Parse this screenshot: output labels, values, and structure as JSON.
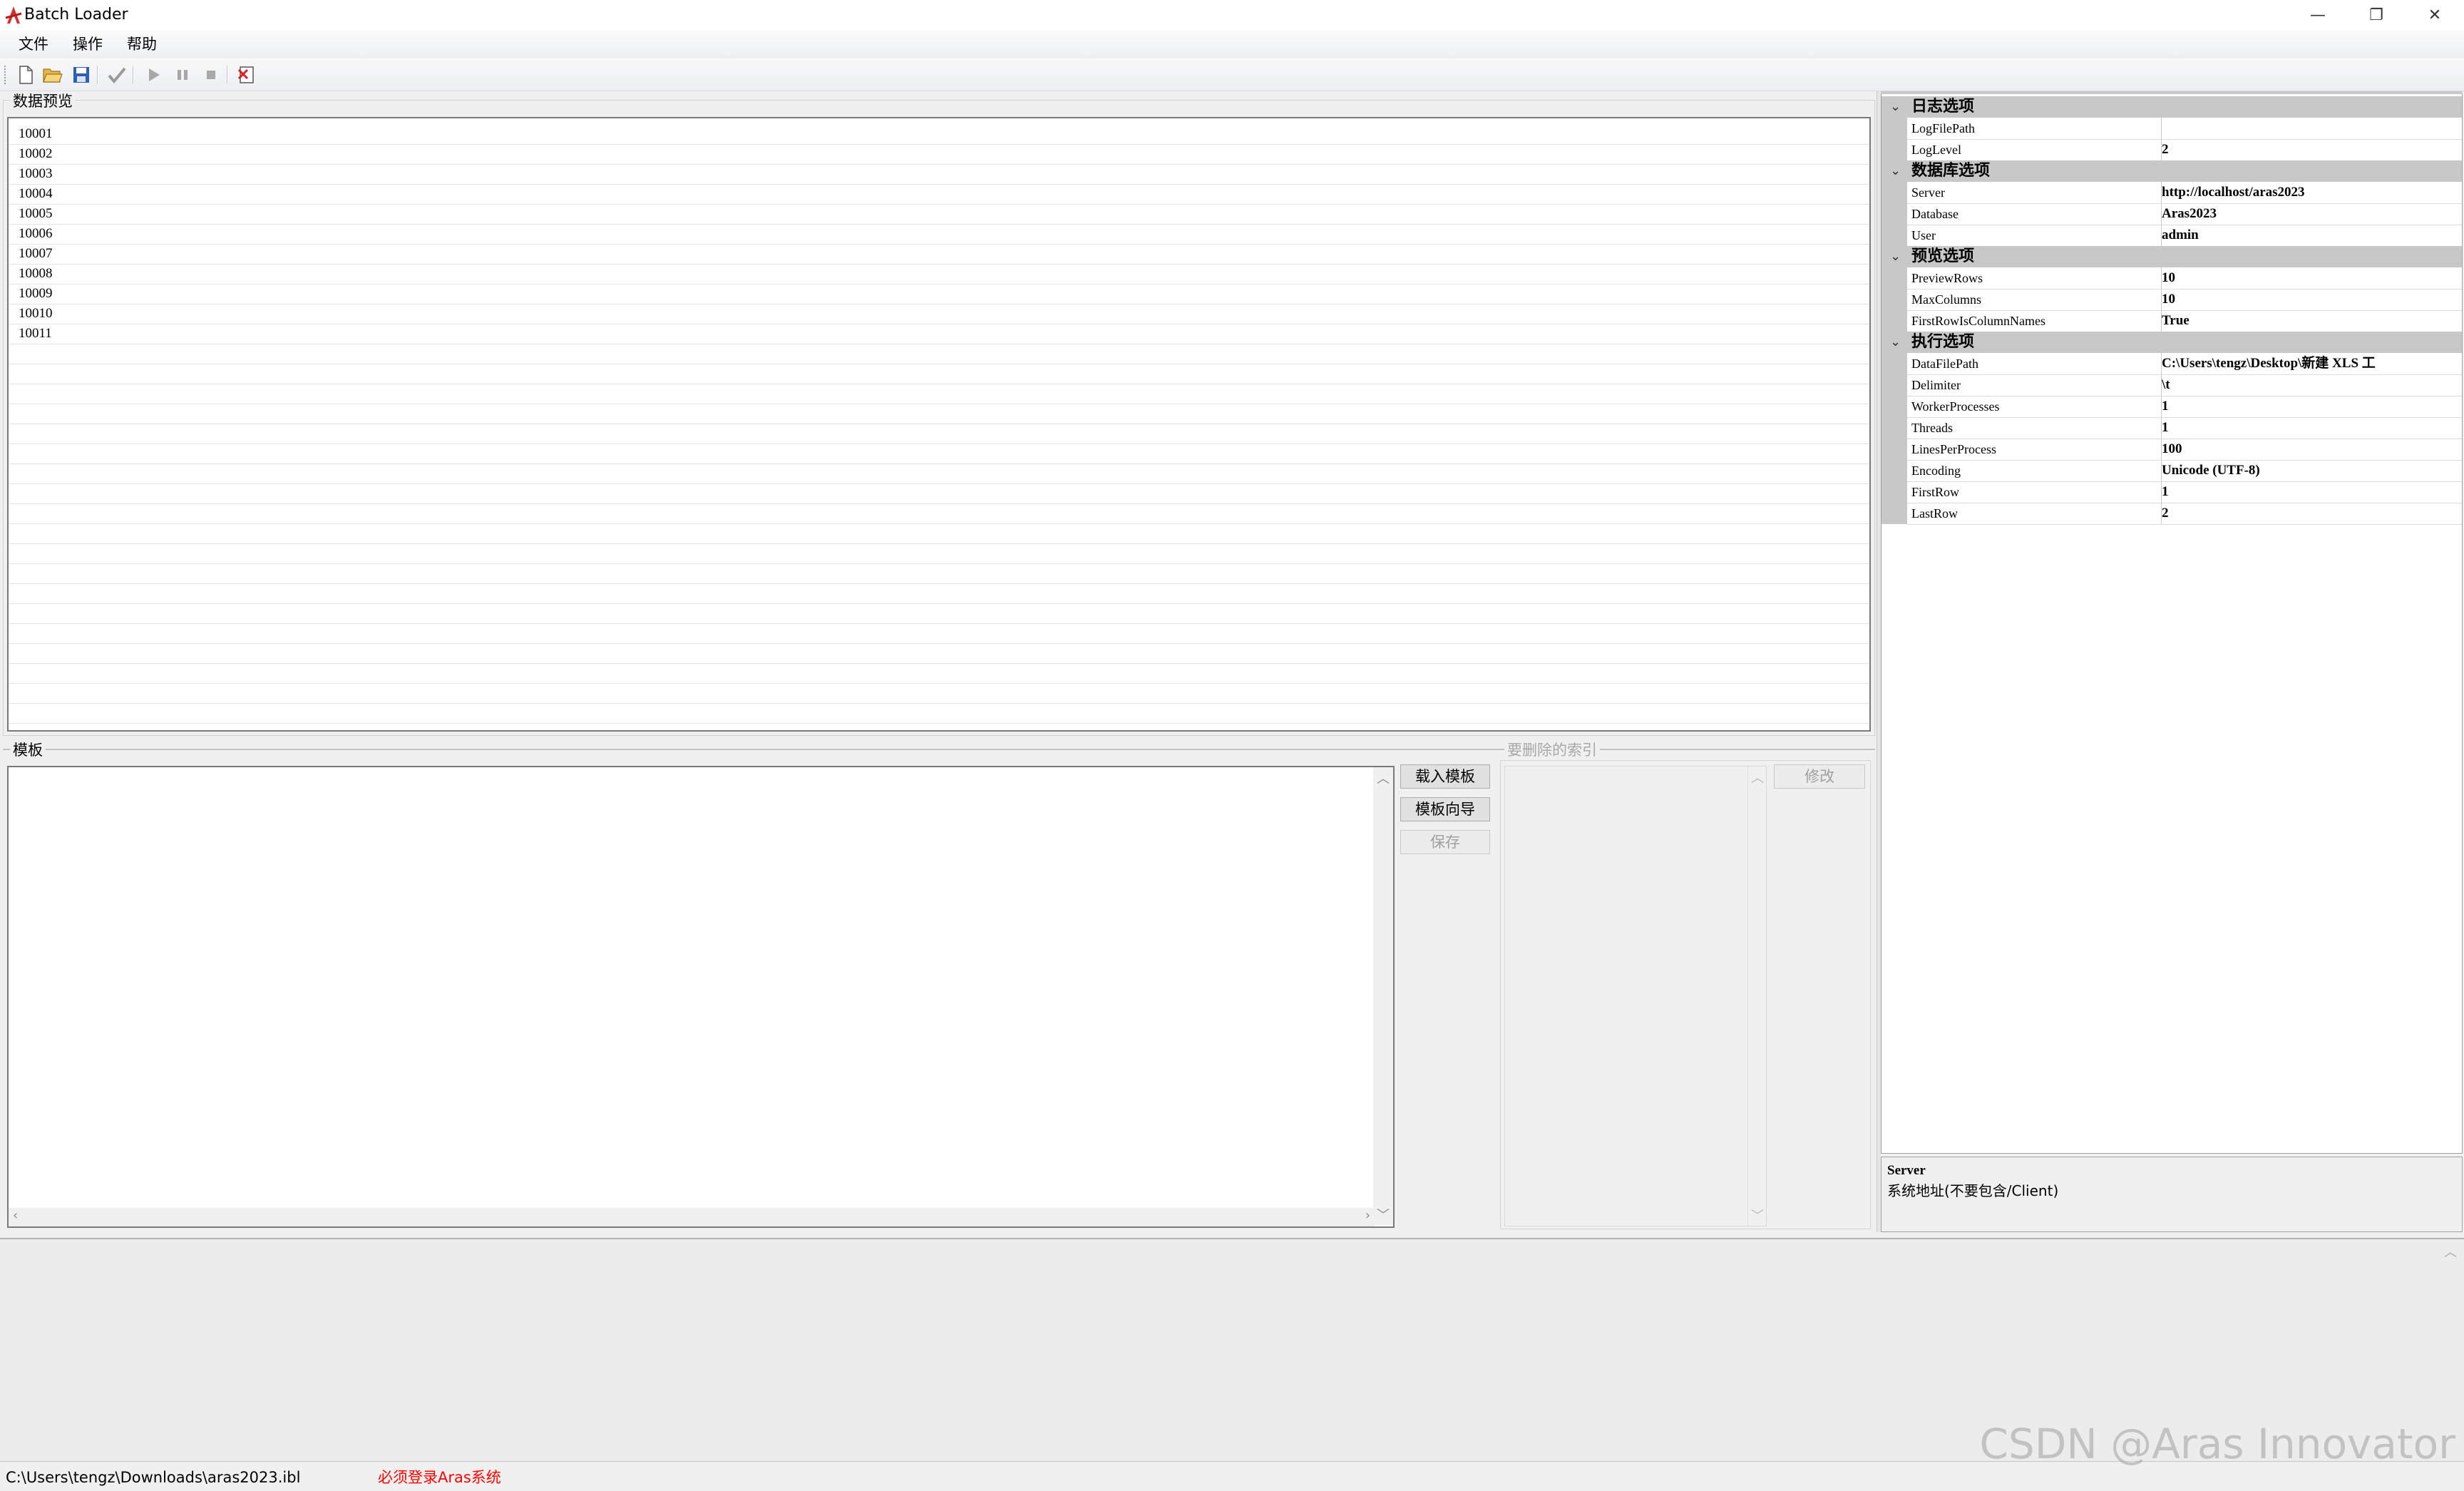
{
  "window": {
    "title": "Batch Loader",
    "controls": {
      "minimize": "—",
      "restore": "❐",
      "close": "✕"
    }
  },
  "menu": [
    "文件",
    "操作",
    "帮助"
  ],
  "toolbar": {
    "buttons": [
      "new-file",
      "open-folder",
      "save",
      "check",
      "run",
      "pause",
      "stop",
      "delete-template"
    ]
  },
  "preview": {
    "label": "数据预览",
    "rows": [
      "10001",
      "10002",
      "10003",
      "10004",
      "10005",
      "10006",
      "10007",
      "10008",
      "10009",
      "10010",
      "10011"
    ]
  },
  "template": {
    "label": "模板",
    "buttons": {
      "load": "载入模板",
      "wizard": "模板向导",
      "save": "保存"
    }
  },
  "index": {
    "label": "要删除的索引",
    "button": "修改"
  },
  "properties": {
    "categories": [
      {
        "name": "日志选项",
        "items": [
          {
            "name": "LogFilePath",
            "value": ""
          },
          {
            "name": "LogLevel",
            "value": "2"
          }
        ]
      },
      {
        "name": "数据库选项",
        "items": [
          {
            "name": "Server",
            "value": "http://localhost/aras2023"
          },
          {
            "name": "Database",
            "value": "Aras2023"
          },
          {
            "name": "User",
            "value": "admin"
          }
        ]
      },
      {
        "name": "预览选项",
        "items": [
          {
            "name": "PreviewRows",
            "value": "10"
          },
          {
            "name": "MaxColumns",
            "value": "10"
          },
          {
            "name": "FirstRowIsColumnNames",
            "value": "True"
          }
        ]
      },
      {
        "name": "执行选项",
        "items": [
          {
            "name": "DataFilePath",
            "value": "C:\\Users\\tengz\\Desktop\\新建 XLS 工"
          },
          {
            "name": "Delimiter",
            "value": "\\t"
          },
          {
            "name": "WorkerProcesses",
            "value": "1"
          },
          {
            "name": "Threads",
            "value": "1"
          },
          {
            "name": "LinesPerProcess",
            "value": "100"
          },
          {
            "name": "Encoding",
            "value": "Unicode (UTF-8)"
          },
          {
            "name": "FirstRow",
            "value": "1"
          },
          {
            "name": "LastRow",
            "value": "2"
          }
        ]
      }
    ],
    "help": {
      "title": "Server",
      "description": "系统地址(不要包含/Client)"
    }
  },
  "status": {
    "path": "C:\\Users\\tengz\\Downloads\\aras2023.ibl",
    "message": "必须登录Aras系统",
    "message_color": "#ff0000"
  },
  "watermark": "CSDN @Aras Innovator"
}
